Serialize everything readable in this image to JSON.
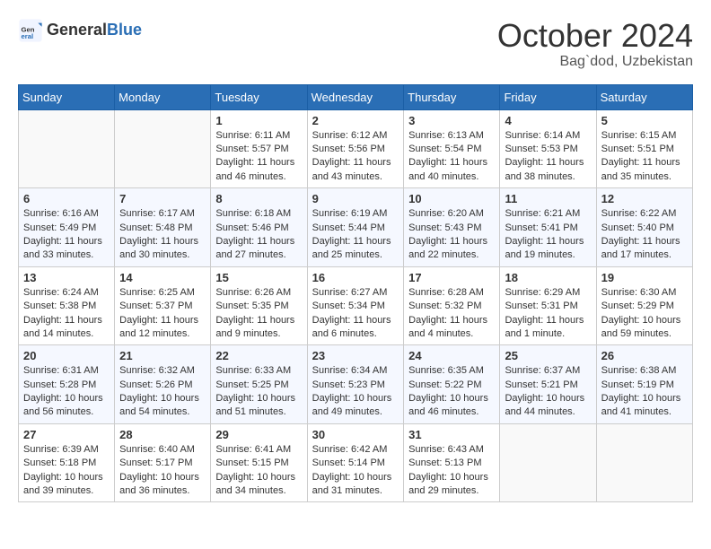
{
  "header": {
    "logo_general": "General",
    "logo_blue": "Blue",
    "title": "October 2024",
    "subtitle": "Bag`dod, Uzbekistan"
  },
  "calendar": {
    "weekdays": [
      "Sunday",
      "Monday",
      "Tuesday",
      "Wednesday",
      "Thursday",
      "Friday",
      "Saturday"
    ],
    "weeks": [
      [
        {
          "day": "",
          "sunrise": "",
          "sunset": "",
          "daylight": ""
        },
        {
          "day": "",
          "sunrise": "",
          "sunset": "",
          "daylight": ""
        },
        {
          "day": "1",
          "sunrise": "Sunrise: 6:11 AM",
          "sunset": "Sunset: 5:57 PM",
          "daylight": "Daylight: 11 hours and 46 minutes."
        },
        {
          "day": "2",
          "sunrise": "Sunrise: 6:12 AM",
          "sunset": "Sunset: 5:56 PM",
          "daylight": "Daylight: 11 hours and 43 minutes."
        },
        {
          "day": "3",
          "sunrise": "Sunrise: 6:13 AM",
          "sunset": "Sunset: 5:54 PM",
          "daylight": "Daylight: 11 hours and 40 minutes."
        },
        {
          "day": "4",
          "sunrise": "Sunrise: 6:14 AM",
          "sunset": "Sunset: 5:53 PM",
          "daylight": "Daylight: 11 hours and 38 minutes."
        },
        {
          "day": "5",
          "sunrise": "Sunrise: 6:15 AM",
          "sunset": "Sunset: 5:51 PM",
          "daylight": "Daylight: 11 hours and 35 minutes."
        }
      ],
      [
        {
          "day": "6",
          "sunrise": "Sunrise: 6:16 AM",
          "sunset": "Sunset: 5:49 PM",
          "daylight": "Daylight: 11 hours and 33 minutes."
        },
        {
          "day": "7",
          "sunrise": "Sunrise: 6:17 AM",
          "sunset": "Sunset: 5:48 PM",
          "daylight": "Daylight: 11 hours and 30 minutes."
        },
        {
          "day": "8",
          "sunrise": "Sunrise: 6:18 AM",
          "sunset": "Sunset: 5:46 PM",
          "daylight": "Daylight: 11 hours and 27 minutes."
        },
        {
          "day": "9",
          "sunrise": "Sunrise: 6:19 AM",
          "sunset": "Sunset: 5:44 PM",
          "daylight": "Daylight: 11 hours and 25 minutes."
        },
        {
          "day": "10",
          "sunrise": "Sunrise: 6:20 AM",
          "sunset": "Sunset: 5:43 PM",
          "daylight": "Daylight: 11 hours and 22 minutes."
        },
        {
          "day": "11",
          "sunrise": "Sunrise: 6:21 AM",
          "sunset": "Sunset: 5:41 PM",
          "daylight": "Daylight: 11 hours and 19 minutes."
        },
        {
          "day": "12",
          "sunrise": "Sunrise: 6:22 AM",
          "sunset": "Sunset: 5:40 PM",
          "daylight": "Daylight: 11 hours and 17 minutes."
        }
      ],
      [
        {
          "day": "13",
          "sunrise": "Sunrise: 6:24 AM",
          "sunset": "Sunset: 5:38 PM",
          "daylight": "Daylight: 11 hours and 14 minutes."
        },
        {
          "day": "14",
          "sunrise": "Sunrise: 6:25 AM",
          "sunset": "Sunset: 5:37 PM",
          "daylight": "Daylight: 11 hours and 12 minutes."
        },
        {
          "day": "15",
          "sunrise": "Sunrise: 6:26 AM",
          "sunset": "Sunset: 5:35 PM",
          "daylight": "Daylight: 11 hours and 9 minutes."
        },
        {
          "day": "16",
          "sunrise": "Sunrise: 6:27 AM",
          "sunset": "Sunset: 5:34 PM",
          "daylight": "Daylight: 11 hours and 6 minutes."
        },
        {
          "day": "17",
          "sunrise": "Sunrise: 6:28 AM",
          "sunset": "Sunset: 5:32 PM",
          "daylight": "Daylight: 11 hours and 4 minutes."
        },
        {
          "day": "18",
          "sunrise": "Sunrise: 6:29 AM",
          "sunset": "Sunset: 5:31 PM",
          "daylight": "Daylight: 11 hours and 1 minute."
        },
        {
          "day": "19",
          "sunrise": "Sunrise: 6:30 AM",
          "sunset": "Sunset: 5:29 PM",
          "daylight": "Daylight: 10 hours and 59 minutes."
        }
      ],
      [
        {
          "day": "20",
          "sunrise": "Sunrise: 6:31 AM",
          "sunset": "Sunset: 5:28 PM",
          "daylight": "Daylight: 10 hours and 56 minutes."
        },
        {
          "day": "21",
          "sunrise": "Sunrise: 6:32 AM",
          "sunset": "Sunset: 5:26 PM",
          "daylight": "Daylight: 10 hours and 54 minutes."
        },
        {
          "day": "22",
          "sunrise": "Sunrise: 6:33 AM",
          "sunset": "Sunset: 5:25 PM",
          "daylight": "Daylight: 10 hours and 51 minutes."
        },
        {
          "day": "23",
          "sunrise": "Sunrise: 6:34 AM",
          "sunset": "Sunset: 5:23 PM",
          "daylight": "Daylight: 10 hours and 49 minutes."
        },
        {
          "day": "24",
          "sunrise": "Sunrise: 6:35 AM",
          "sunset": "Sunset: 5:22 PM",
          "daylight": "Daylight: 10 hours and 46 minutes."
        },
        {
          "day": "25",
          "sunrise": "Sunrise: 6:37 AM",
          "sunset": "Sunset: 5:21 PM",
          "daylight": "Daylight: 10 hours and 44 minutes."
        },
        {
          "day": "26",
          "sunrise": "Sunrise: 6:38 AM",
          "sunset": "Sunset: 5:19 PM",
          "daylight": "Daylight: 10 hours and 41 minutes."
        }
      ],
      [
        {
          "day": "27",
          "sunrise": "Sunrise: 6:39 AM",
          "sunset": "Sunset: 5:18 PM",
          "daylight": "Daylight: 10 hours and 39 minutes."
        },
        {
          "day": "28",
          "sunrise": "Sunrise: 6:40 AM",
          "sunset": "Sunset: 5:17 PM",
          "daylight": "Daylight: 10 hours and 36 minutes."
        },
        {
          "day": "29",
          "sunrise": "Sunrise: 6:41 AM",
          "sunset": "Sunset: 5:15 PM",
          "daylight": "Daylight: 10 hours and 34 minutes."
        },
        {
          "day": "30",
          "sunrise": "Sunrise: 6:42 AM",
          "sunset": "Sunset: 5:14 PM",
          "daylight": "Daylight: 10 hours and 31 minutes."
        },
        {
          "day": "31",
          "sunrise": "Sunrise: 6:43 AM",
          "sunset": "Sunset: 5:13 PM",
          "daylight": "Daylight: 10 hours and 29 minutes."
        },
        {
          "day": "",
          "sunrise": "",
          "sunset": "",
          "daylight": ""
        },
        {
          "day": "",
          "sunrise": "",
          "sunset": "",
          "daylight": ""
        }
      ]
    ]
  }
}
